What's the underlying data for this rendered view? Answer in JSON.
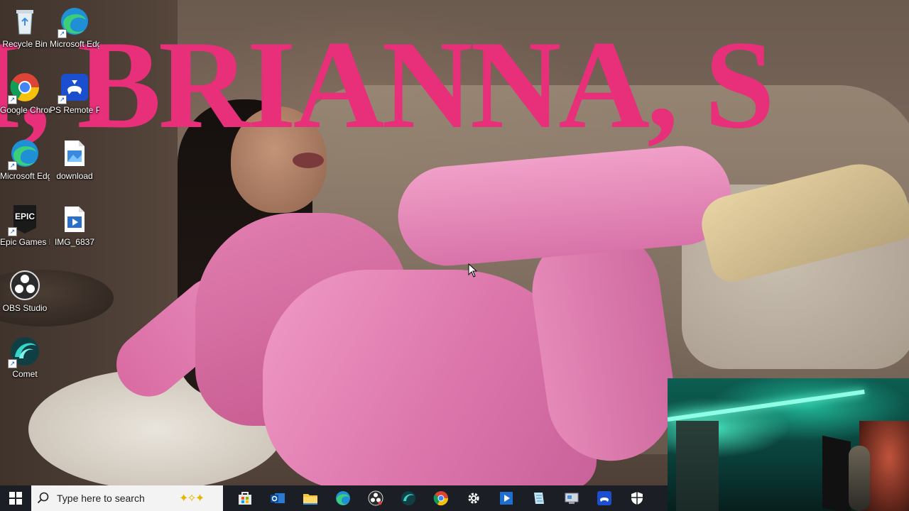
{
  "wallpaper": {
    "headline": "I, BRIANNA, S"
  },
  "desktop_icons": [
    {
      "label": "Recycle Bin",
      "icon": "recycle-bin-icon"
    },
    {
      "label": "Microsoft Edge",
      "icon": "edge-icon"
    },
    {
      "label": "Google Chrome",
      "icon": "chrome-icon"
    },
    {
      "label": "PS Remote Play",
      "icon": "ps-remote-play-icon"
    },
    {
      "label": "Microsoft Edge - Copy",
      "icon": "edge-icon"
    },
    {
      "label": "download",
      "icon": "image-file-icon"
    },
    {
      "label": "Epic Games Launcher",
      "icon": "epic-games-icon",
      "glyph": "EPIC"
    },
    {
      "label": "IMG_6837",
      "icon": "video-file-icon"
    },
    {
      "label": "OBS Studio",
      "icon": "obs-icon"
    },
    {
      "label": "Comet",
      "icon": "comet-icon"
    }
  ],
  "taskbar": {
    "search_placeholder": "Type here to search",
    "pinned": [
      {
        "name": "store",
        "icon": "store-icon"
      },
      {
        "name": "outlook",
        "icon": "outlook-icon"
      },
      {
        "name": "file-explorer",
        "icon": "folder-icon"
      },
      {
        "name": "edge",
        "icon": "edge-icon"
      },
      {
        "name": "obs",
        "icon": "obs-icon"
      },
      {
        "name": "comet",
        "icon": "comet-icon"
      },
      {
        "name": "chrome",
        "icon": "chrome-icon"
      },
      {
        "name": "settings",
        "icon": "gear-icon"
      },
      {
        "name": "media-player",
        "icon": "media-player-icon"
      },
      {
        "name": "notepad",
        "icon": "notepad-icon"
      },
      {
        "name": "control-panel",
        "icon": "control-panel-icon"
      },
      {
        "name": "ps-remote-play",
        "icon": "ps-remote-play-icon"
      },
      {
        "name": "security",
        "icon": "shield-icon"
      }
    ]
  },
  "colors": {
    "headline": "#e72f7a",
    "taskbar": "#1b1e24",
    "search_box": "#f3f3f3"
  }
}
